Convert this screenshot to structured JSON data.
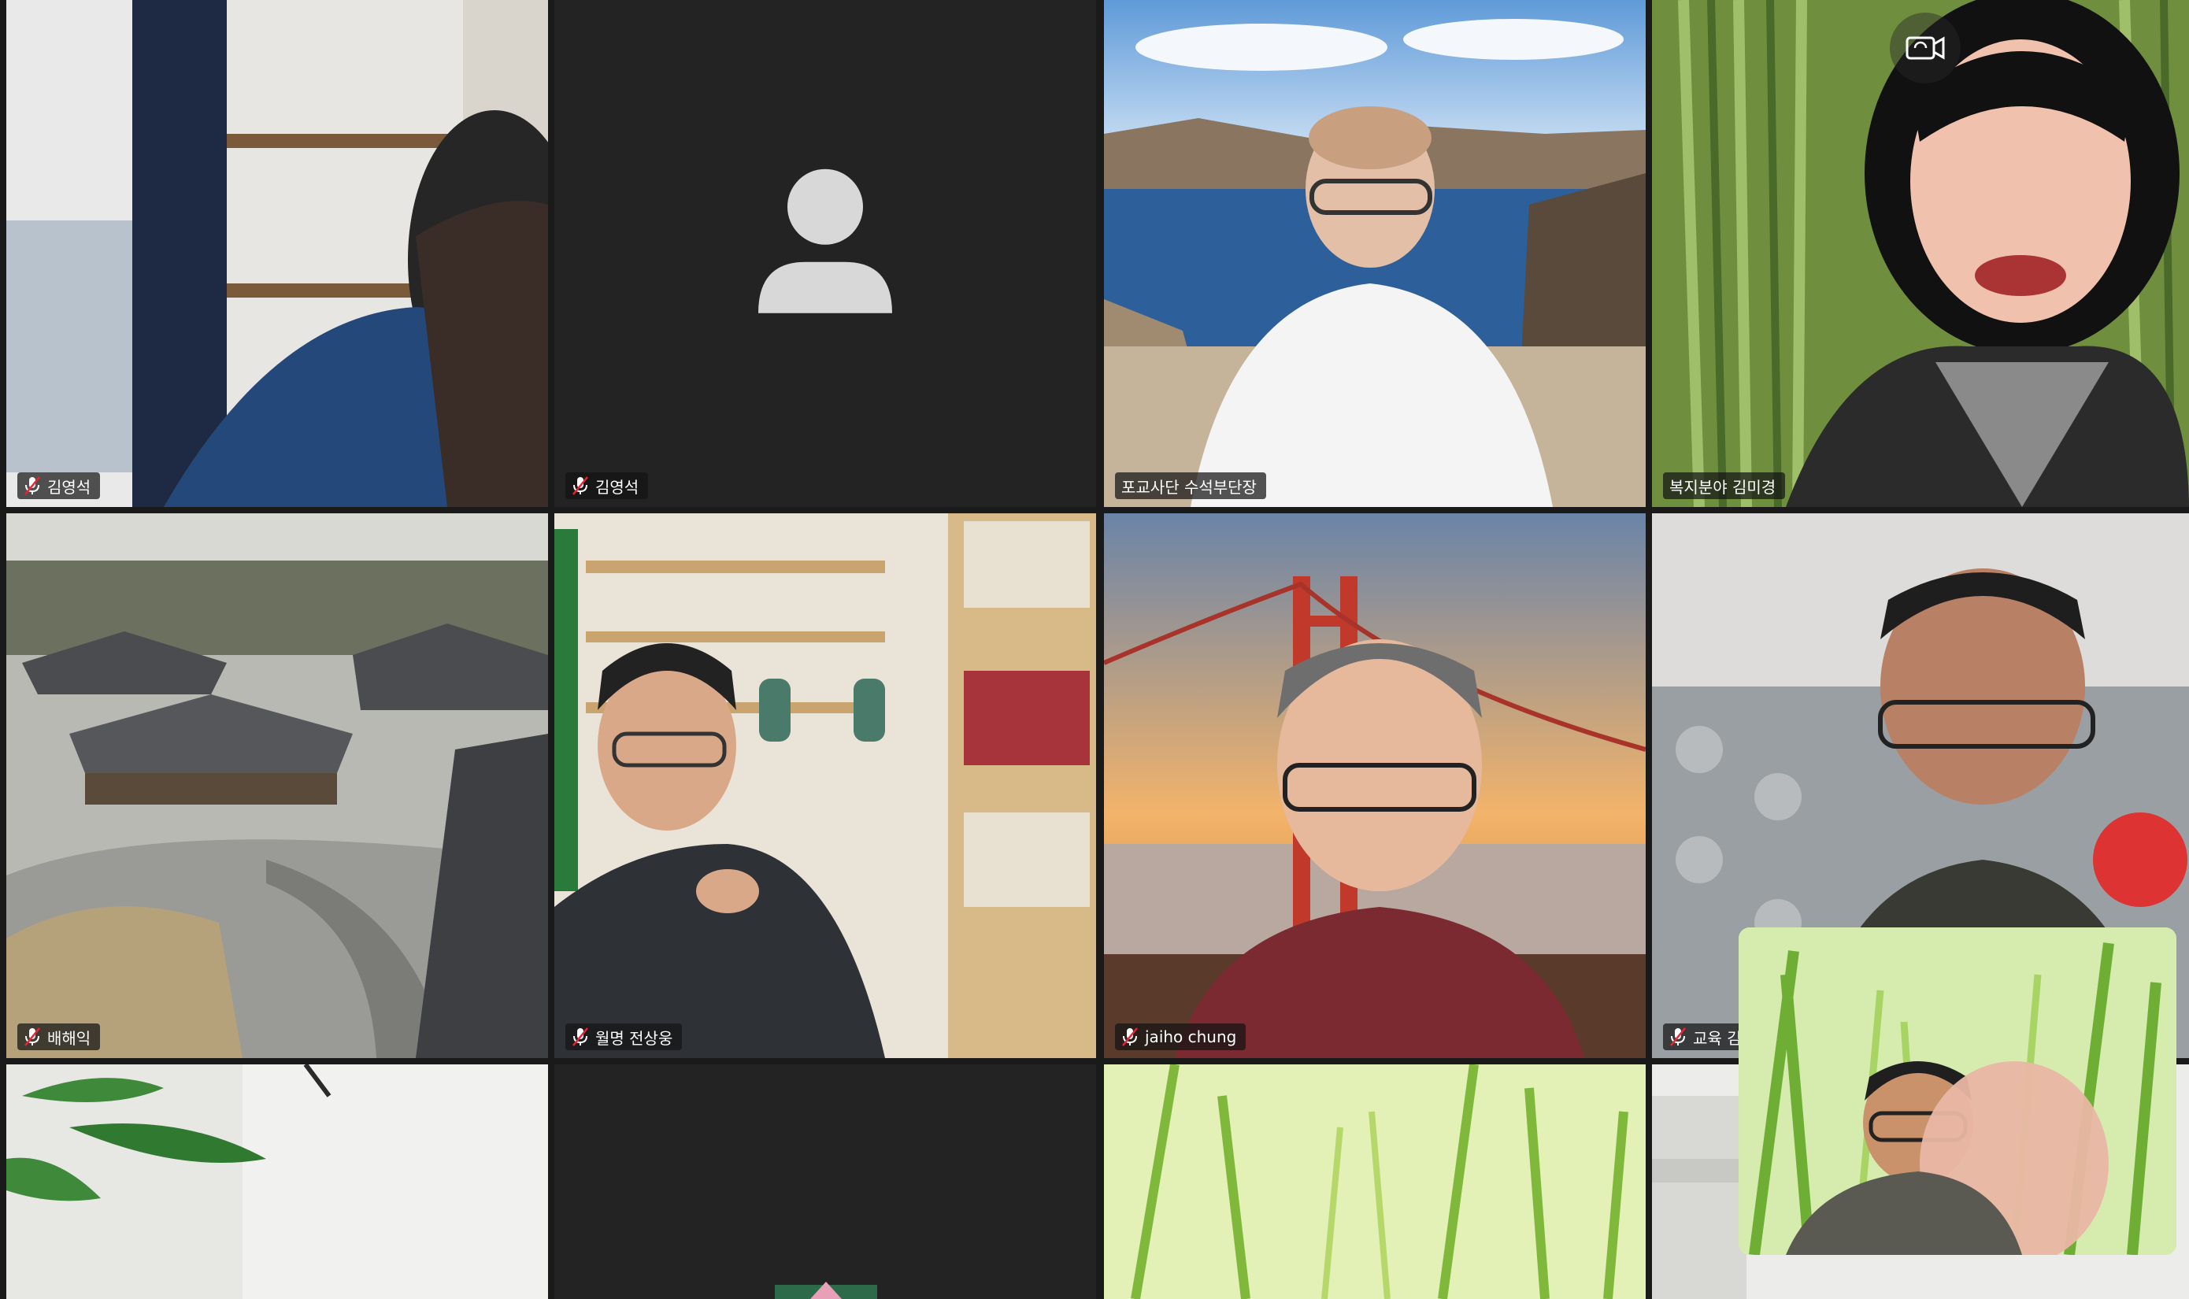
{
  "window": {
    "app": "video-conference-gallery-view"
  },
  "participants": [
    {
      "name": "김영석",
      "muted": true,
      "video": true,
      "scene": "office-shelf"
    },
    {
      "name": "김영석",
      "muted": true,
      "video": false,
      "scene": "avatar-placeholder"
    },
    {
      "name": "포교사단 수석부단장",
      "muted": false,
      "video": true,
      "scene": "mountain-lake"
    },
    {
      "name": "복지분야 김미경",
      "muted": false,
      "video": true,
      "scene": "bamboo",
      "speaking": true
    },
    {
      "name": "배해익",
      "muted": true,
      "video": true,
      "scene": "temple-roofs"
    },
    {
      "name": "월명 전상웅",
      "muted": true,
      "video": true,
      "scene": "bookshelf-room"
    },
    {
      "name": "jaiho chung",
      "muted": true,
      "video": true,
      "scene": "golden-gate"
    },
    {
      "name": "교육 김",
      "muted": true,
      "video": true,
      "scene": "grey-wall"
    },
    {
      "name": "",
      "muted": false,
      "video": true,
      "scene": "white-plant"
    },
    {
      "name": "",
      "muted": false,
      "video": false,
      "scene": "dark"
    },
    {
      "name": "",
      "muted": false,
      "video": true,
      "scene": "green-grass"
    },
    {
      "name": "",
      "muted": false,
      "video": true,
      "scene": "white-room"
    }
  ],
  "self_view": {
    "scene": "green-grass-self"
  },
  "icons": {
    "mic_muted": "mic-muted-icon",
    "camera": "camera-switch-icon",
    "avatar": "user-avatar-icon"
  },
  "colors": {
    "speaking_border": "#2fd35b",
    "tile_bg": "#232323",
    "gap": "#1a1a1a"
  }
}
